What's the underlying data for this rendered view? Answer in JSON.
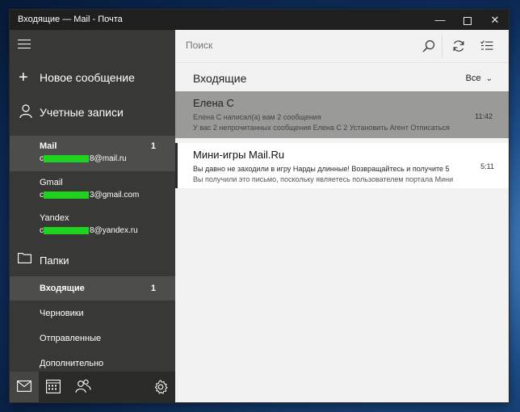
{
  "window": {
    "title": "Входящие — Mail - Почта",
    "controls": {
      "minimize": "—",
      "maximize": "",
      "close": "✕"
    }
  },
  "sidebar": {
    "new_message": "Новое сообщение",
    "accounts_header": "Учетные записи",
    "accounts": [
      {
        "name": "Mail",
        "count": "1",
        "email_prefix": "c",
        "email_suffix": "8@mail.ru",
        "selected": true
      },
      {
        "name": "Gmail",
        "count": "",
        "email_prefix": "c",
        "email_suffix": "3@gmail.com",
        "selected": false
      },
      {
        "name": "Yandex",
        "count": "",
        "email_prefix": "c",
        "email_suffix": "8@yandex.ru",
        "selected": false
      }
    ],
    "folders_header": "Папки",
    "folders": [
      {
        "label": "Входящие",
        "count": "1",
        "selected": true
      },
      {
        "label": "Черновики",
        "count": "",
        "selected": false
      },
      {
        "label": "Отправленные",
        "count": "",
        "selected": false
      },
      {
        "label": "Дополнительно",
        "count": "",
        "selected": false
      }
    ],
    "bottom_icons": [
      "mail-icon",
      "calendar-icon",
      "people-icon",
      "settings-icon"
    ]
  },
  "search": {
    "placeholder": "Поиск"
  },
  "list": {
    "title": "Входящие",
    "filter": "Все",
    "messages": [
      {
        "sender": "Елена С",
        "line2": "Елена С написал(а) вам 2 сообщения",
        "line3": "У вас 2 непрочитанных сообщения Елена С 2 Установить Агент Отписаться",
        "time": "11:42",
        "selected": true
      },
      {
        "sender": "Мини-игры Mail.Ru",
        "line2": "Вы давно не заходили в игру Нарды длинные! Возвращайтесь и получите 5",
        "line3": "Вы получили это письмо, поскольку являетесь пользователем портала Мини",
        "time": "5:11",
        "selected": false
      }
    ]
  },
  "colors": {
    "sidebar_bg": "#383837",
    "sidebar_selected": "#4d4d4c",
    "selected_message": "#9a9a99",
    "redaction": "#1fd21f"
  }
}
